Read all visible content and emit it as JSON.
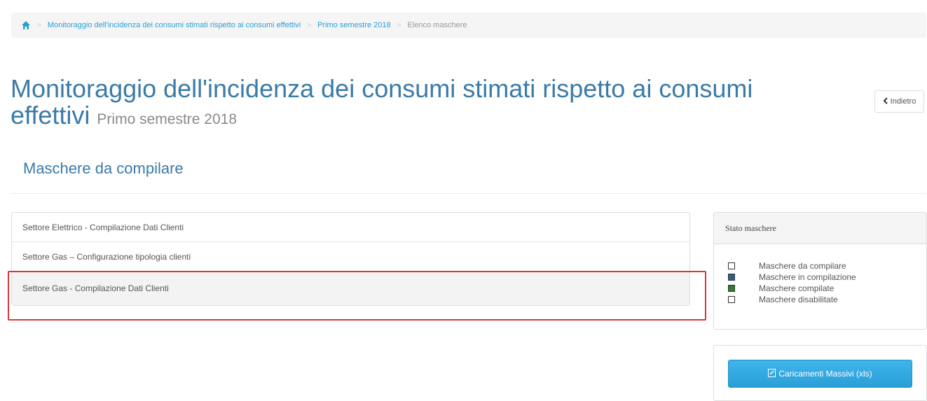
{
  "breadcrumb": {
    "items": [
      "Monitoraggio dell'incidenza dei consumi stimati rispetto ai consumi effettivi",
      "Primo semestre 2018",
      "Elenco maschere"
    ]
  },
  "header": {
    "title": "Monitoraggio dell'incidenza dei consumi stimati rispetto ai consumi effettivi",
    "subtitle": "Primo semestre 2018",
    "back_label": "Indietro"
  },
  "section": {
    "title": "Maschere da compilare"
  },
  "masks": [
    {
      "label": "Settore Elettrico - Compilazione Dati Clienti"
    },
    {
      "label": "Settore Gas – Configurazione tipologia clienti"
    },
    {
      "label": "Settore Gas - Compilazione Dati Clienti"
    }
  ],
  "status_panel": {
    "title": "Stato maschere",
    "legend": [
      {
        "label": "Maschere da compilare",
        "color": "#ffffff"
      },
      {
        "label": "Maschere in compilazione",
        "color": "#2f5f85"
      },
      {
        "label": "Maschere compilate",
        "color": "#2f7d32"
      },
      {
        "label": "Maschere disabilitate",
        "color": "#ffffff"
      }
    ]
  },
  "bulk": {
    "label": "Caricamenti Massivi (xls)"
  },
  "colors": {
    "accent": "#2a9fd6",
    "title": "#3a7ba8",
    "highlight": "#d9363e"
  }
}
